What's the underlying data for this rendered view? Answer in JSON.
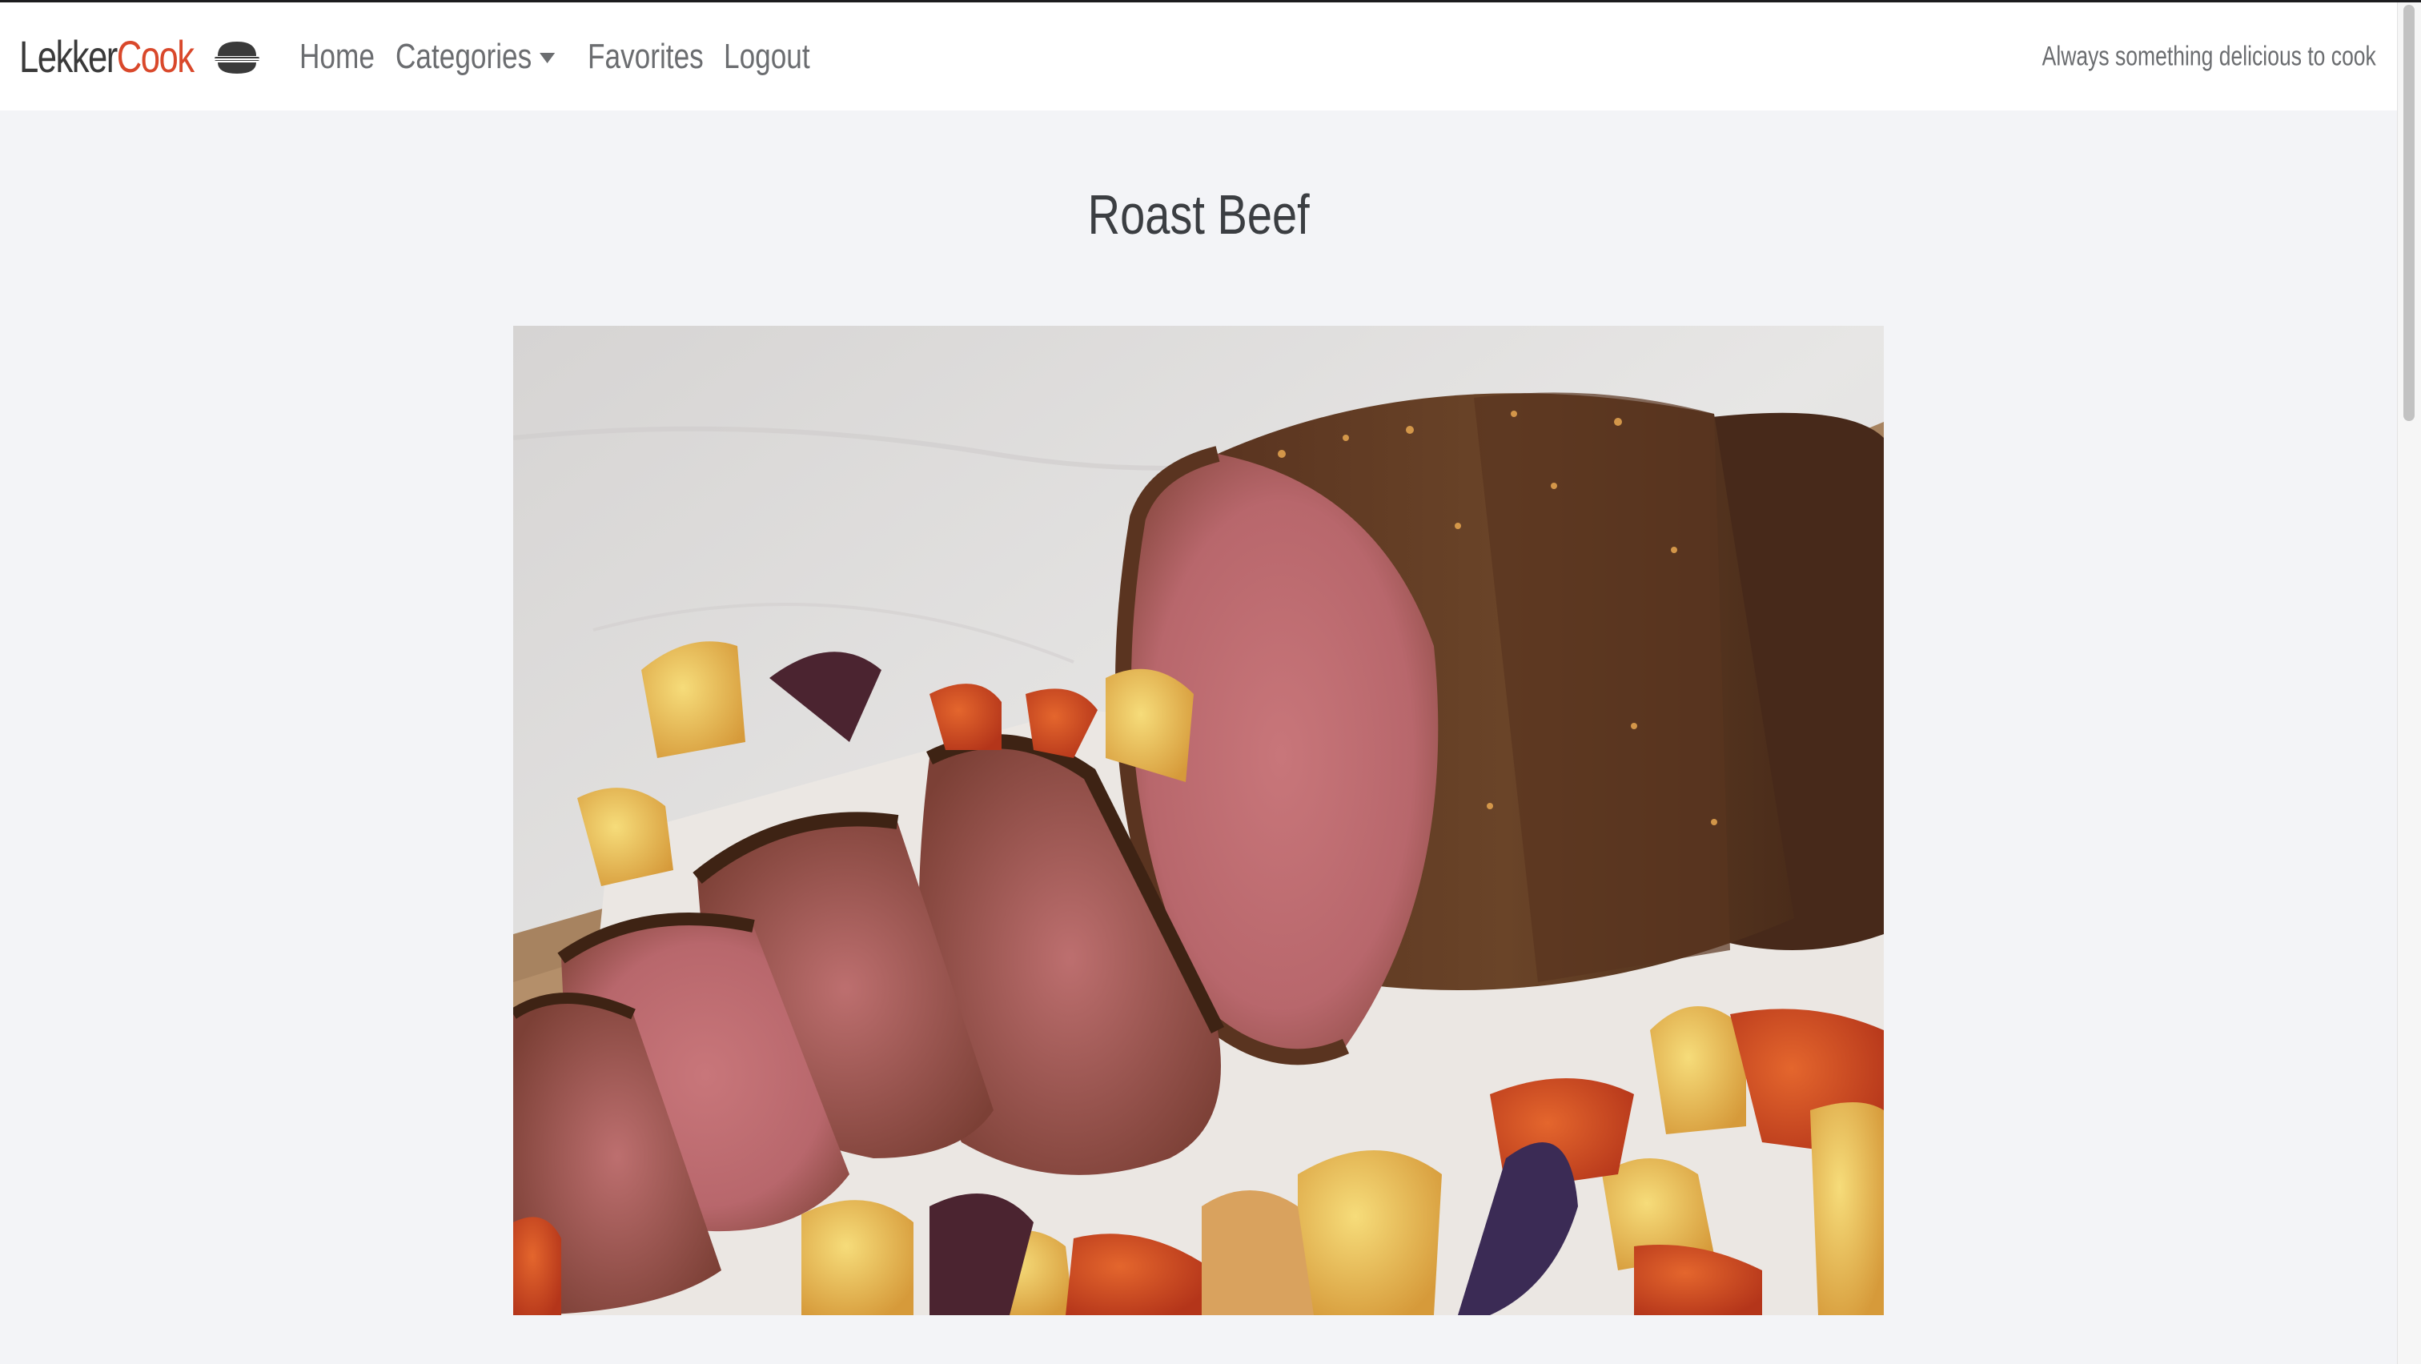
{
  "navbar": {
    "brand_part1": "Lekker",
    "brand_part2": "Cook",
    "brand_icon": "cooking-pot-icon",
    "items": [
      {
        "label": "Home"
      },
      {
        "label": "Categories"
      },
      {
        "label": "Favorites"
      },
      {
        "label": "Logout"
      }
    ],
    "tagline": "Always something delicious to cook"
  },
  "recipe": {
    "title": "Roast Beef",
    "image_alt": "Roast beef sliced with roasted vegetables"
  },
  "colors": {
    "accent": "#d9482b",
    "background": "#f3f4f7",
    "nav_text": "#6b6d70"
  }
}
